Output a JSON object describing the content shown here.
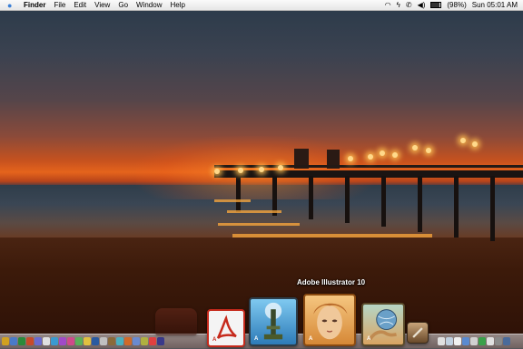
{
  "menubar": {
    "app_name": "Finder",
    "menus": [
      "File",
      "Edit",
      "View",
      "Go",
      "Window",
      "Help"
    ],
    "battery_text": "(98%)",
    "clock": "Sun 05:01 AM"
  },
  "dock": {
    "hover_label": "Adobe Illustrator 10",
    "icons": [
      "adobe-acrobat-icon",
      "adobe-distiller-icon",
      "adobe-illustrator-icon",
      "adobe-imageready-icon",
      "hand-icon"
    ]
  }
}
